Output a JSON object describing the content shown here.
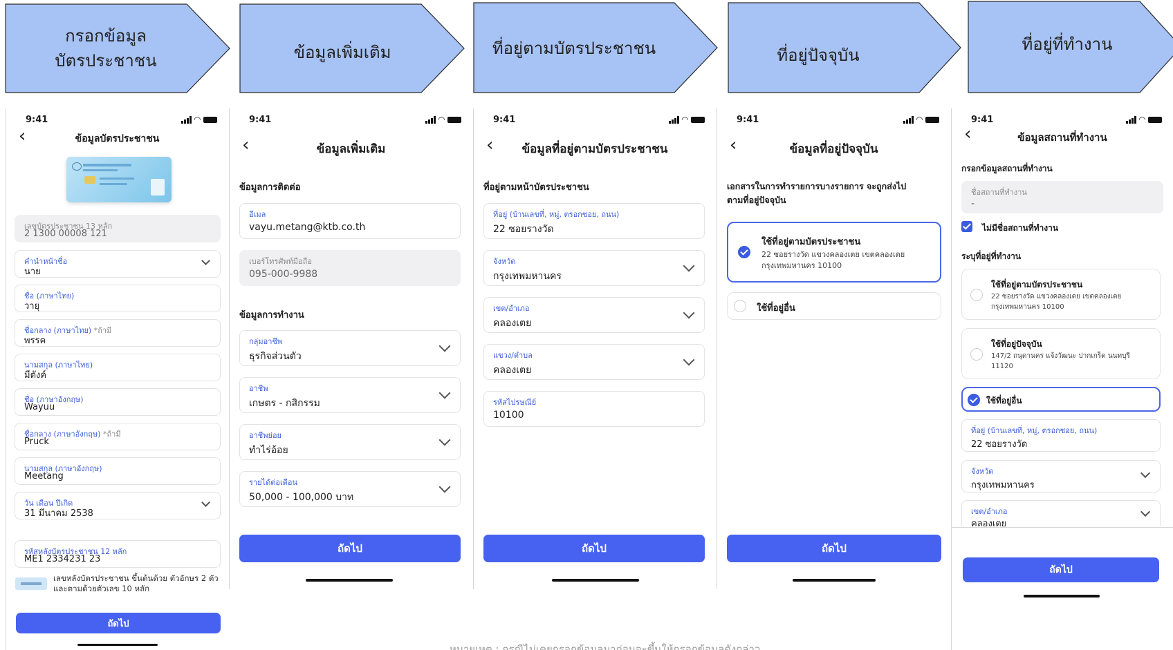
{
  "steps": [
    {
      "label": "กรอกข้อมูล\nบัตรประชาชน"
    },
    {
      "label": "ข้อมูลเพิ่มเติม"
    },
    {
      "label": "ที่อยู่ตามบัตรประชาชน"
    },
    {
      "label": "ที่อยู่ปัจจุบัน"
    },
    {
      "label": "ที่อยู่ที่ทำงาน"
    }
  ],
  "colors": {
    "step_fill": "#a7c2f4",
    "accent": "#4762f0",
    "label_blue": "#3d5fd9"
  },
  "status_time": "9:41",
  "next_label": "ถัดไป",
  "screen1": {
    "title": "ข้อมูลบัตรประชาชน",
    "fields": [
      {
        "label": "เลขบัตรประชาชน 13 หลัก",
        "value": "2 1300 00008 121"
      },
      {
        "label": "คำนำหน้าชื่อ",
        "value": "นาย"
      },
      {
        "label": "ชื่อ (ภาษาไทย)",
        "value": "วายุ"
      },
      {
        "label": "ชื่อกลาง (ภาษาไทย)",
        "optional": "*ถ้ามี",
        "value": "พรรค"
      },
      {
        "label": "นามสกุล (ภาษาไทย)",
        "value": "มีตังค์"
      },
      {
        "label": "ชื่อ (ภาษาอังกฤษ)",
        "value": "Wayuu"
      },
      {
        "label": "ชื่อกลาง (ภาษาอังกฤษ)",
        "optional": "*ถ้ามี",
        "value": "Pruck"
      },
      {
        "label": "นามสกุล (ภาษาอังกฤษ)",
        "value": "Meetang"
      },
      {
        "label": "วัน เดือน ปีเกิด",
        "value": "31 มีนาคม 2538"
      },
      {
        "label": "รหัสหลังบัตรประชาชน 12 หลัก",
        "value": "ME1 2334231 23"
      }
    ],
    "hint": "เลขหลังบัตรประชาชน ขึ้นต้นด้วย ตัวอักษร 2 ตัว และตามด้วยตัวเลข 10 หลัก"
  },
  "screen2": {
    "title": "ข้อมูลเพิ่มเติม",
    "contact_section": "ข้อมูลการติดต่อ",
    "work_section": "ข้อมูลการทำงาน",
    "fields": [
      {
        "label": "อีเมล",
        "value": "vayu.metang@ktb.co.th"
      },
      {
        "label": "เบอร์โทรศัพท์มือถือ",
        "value": "095-000-9988"
      },
      {
        "label": "กลุ่มอาชีพ",
        "value": "ธุรกิจส่วนตัว"
      },
      {
        "label": "อาชีพ",
        "value": "เกษตร - กสิกรรม"
      },
      {
        "label": "อาชีพย่อย",
        "value": "ทำไร่อ้อย"
      },
      {
        "label": "รายได้ต่อเดือน",
        "value": "50,000 - 100,000 บาท"
      }
    ]
  },
  "screen3": {
    "title": "ข้อมูลที่อยู่ตามบัตรประชาชน",
    "section": "ที่อยู่ตามหน้าบัตรประชาชน",
    "fields": [
      {
        "label": "ที่อยู่ (บ้านเลขที่, หมู่, ตรอกซอย, ถนน)",
        "value": "22 ซอยรางวัด"
      },
      {
        "label": "จังหวัด",
        "value": "กรุงเทพมหานคร"
      },
      {
        "label": "เขต/อำเภอ",
        "value": "คลองเตย"
      },
      {
        "label": "แขวง/ตำบล",
        "value": "คลองเตย"
      },
      {
        "label": "รหัสไปรษณีย์",
        "value": "10100"
      }
    ]
  },
  "screen4": {
    "title": "ข้อมูลที่อยู่ปัจจุบัน",
    "desc": "เอกสารในการทำรายการบางรายการ จะถูกส่งไป\nตามที่อยู่ปัจจุบัน",
    "option1_title": "ใช้ที่อยู่ตามบัตรประชาชน",
    "option1_desc": "22 ซอยรางวัด แขวงคลองเตย เขตคลองเตย\nกรุงเทพมหานคร 10100",
    "option2_title": "ใช้ที่อยู่อื่น"
  },
  "screen5": {
    "title": "ข้อมูลสถานที่ทำงาน",
    "section": "กรอกข้อมูลสถานที่ทำงาน",
    "workplace_label": "ชื่อสถานที่ทำงาน",
    "workplace_value": "-",
    "no_workplace": "ไม่มีชื่อสถานที่ทำงาน",
    "address_section": "ระบุที่อยู่ที่ทำงาน",
    "option1_title": "ใช้ที่อยู่ตามบัตรประชาชน",
    "option1_desc": "22 ซอยรางวัด แขวงคลองเตย เขตคลองเตย\nกรุงเทพมหานคร 10100",
    "option2_title": "ใช้ที่อยู่ปัจจุบัน",
    "option2_desc": "147/2 ถนุดานคร แจ้งวัฒนะ ปากเกร็ด นนทบุรี\n11120",
    "option3_title": "ใช้ที่อยู่อื่น",
    "fields": [
      {
        "label": "ที่อยู่ (บ้านเลขที่, หมู่, ตรอกซอย, ถนน)",
        "value": "22 ซอยรางวัด"
      },
      {
        "label": "จังหวัด",
        "value": "กรุงเทพมหานคร"
      },
      {
        "label": "เขต/อำเภอ",
        "value": "คลองเตย"
      }
    ]
  },
  "footnote": "หมายเหตุ : กรณีไม่เคยกรอกข้อมูลมาก่อนจะขึ้นให้กรอกข้อมูลดังกล่าว"
}
